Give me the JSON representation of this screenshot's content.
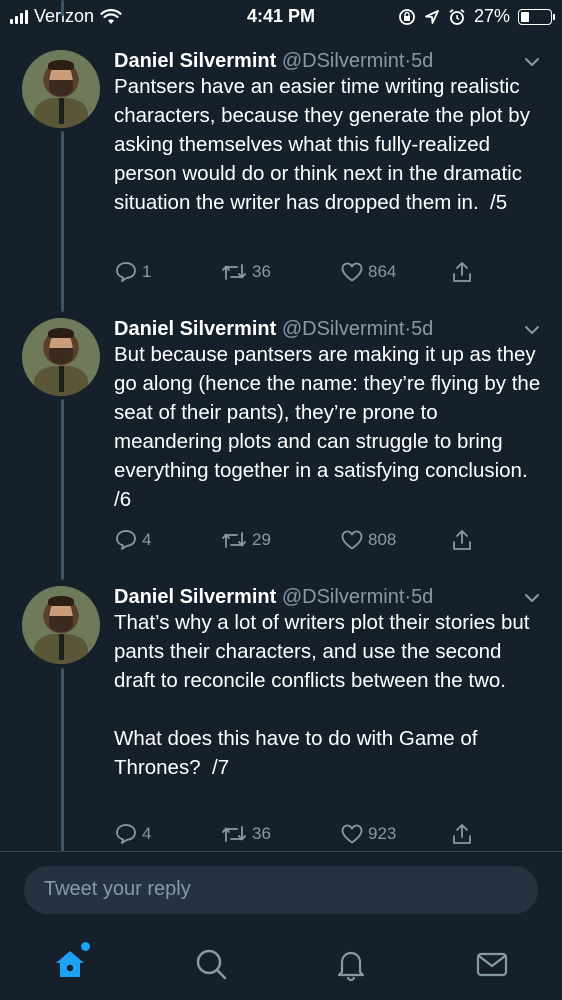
{
  "status_bar": {
    "carrier": "Verizon",
    "time": "4:41 PM",
    "battery": "27%",
    "battery_level": 0.27,
    "icons": [
      "signal-icon",
      "wifi-icon",
      "screen-lock-icon",
      "location-icon",
      "alarm-icon",
      "battery-icon"
    ]
  },
  "tweets": [
    {
      "name": "Daniel Silvermint",
      "handle": "@DSilvermint",
      "dot": "·",
      "time": "5d",
      "text": "Pantsers have an easier time writing realistic characters, because they generate the plot by asking themselves what this fully-realized person would do or think next in the dramatic situation the writer has dropped them in.  /5",
      "replies": "1",
      "retweets": "36",
      "likes": "864"
    },
    {
      "name": "Daniel Silvermint",
      "handle": "@DSilvermint",
      "dot": "·",
      "time": "5d",
      "text": "But because pantsers are making it up as they go along (hence the name: they’re flying by the seat of their pants), they’re prone to meandering plots and can struggle to bring everything together in a satisfying conclusion.  /6",
      "replies": "4",
      "retweets": "29",
      "likes": "808"
    },
    {
      "name": "Daniel Silvermint",
      "handle": "@DSilvermint",
      "dot": "·",
      "time": "5d",
      "text": "That’s why a lot of writers plot their stories but pants their characters, and use the second draft to reconcile conflicts between the two.\n\nWhat does this have to do with Game of Thrones?  /7",
      "replies": "4",
      "retweets": "36",
      "likes": "923"
    }
  ],
  "reply": {
    "placeholder": "Tweet your reply"
  },
  "tab_bar": {
    "tabs": [
      "home-icon",
      "search-icon",
      "notifications-icon",
      "messages-icon"
    ],
    "accent": "#1da1f2"
  },
  "colors": {
    "background": "#15202b",
    "secondary_text": "#8899a6",
    "reply_box": "#253341"
  }
}
